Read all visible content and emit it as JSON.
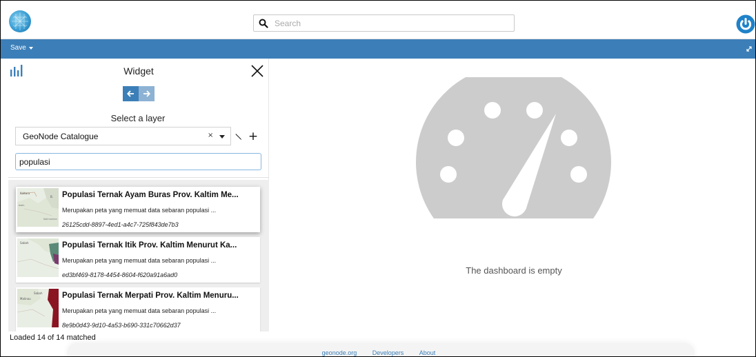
{
  "header": {
    "search_placeholder": "Search"
  },
  "toolbar": {
    "save_label": "Save"
  },
  "widget_panel": {
    "title": "Widget",
    "select_label": "Select a layer",
    "catalog_value": "GeoNode Catalogue",
    "clear_symbol": "×",
    "add_symbol": "+",
    "filter_value": "populasi",
    "status": "Loaded 14 of 14 matched",
    "results": [
      {
        "title": "Populasi Ternak Ayam Buras Prov. Kaltim Me...",
        "description": "Merupakan peta yang memuat data sebaran populasi ...",
        "id": "26125cdd-8897-4ed1-a4c7-725f843de7b3"
      },
      {
        "title": "Populasi Ternak Itik Prov. Kaltim Menurut Ka...",
        "description": "Merupakan peta yang memuat data sebaran populasi ...",
        "id": "ed3bf469-8178-4454-8604-f620a91a6ad0"
      },
      {
        "title": "Populasi Ternak Merpati Prov. Kaltim Menuru...",
        "description": "Merupakan peta yang memuat data sebaran populasi ...",
        "id": "8e9b0d43-9d10-4a53-b690-331c70662d37"
      }
    ]
  },
  "dashboard": {
    "empty_message": "The dashboard is empty"
  },
  "footer": {
    "links": [
      "geonode.org",
      "Developers",
      "About"
    ]
  },
  "colors": {
    "brand_blue": "#3c7fb8",
    "gauge_gray": "#cccccc"
  }
}
